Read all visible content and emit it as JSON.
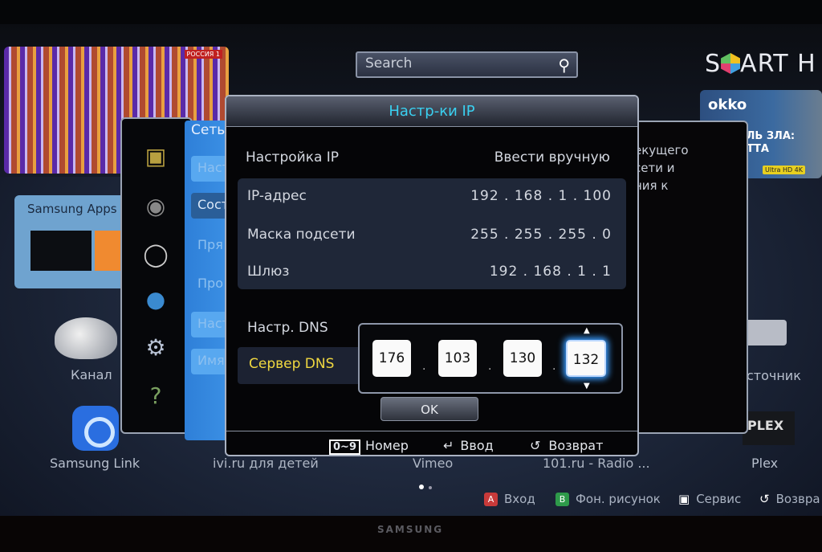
{
  "brand": "SAMSUNG",
  "hub": {
    "logo": "SMART HUB",
    "search_placeholder": "Search",
    "preview_channel": "РОССИЯ 1",
    "okko": {
      "logo": "okko",
      "promo": "ОБИТЕЛЬ ЗЛА: ВЕНДЕТТА",
      "badge": "Ultra HD 4K"
    },
    "tiles": [
      {
        "label": "Samsung Apps"
      },
      {
        "label": "Канал"
      },
      {
        "label": "Samsung Link"
      },
      {
        "label": "Источник"
      },
      {
        "label": "Plex"
      },
      {
        "label": "ivi.ru для детей"
      },
      {
        "label": "Vimeo"
      },
      {
        "label": "101.ru - Radio ..."
      }
    ],
    "plex_logo": "PLEX",
    "page_dots": {
      "current": 1,
      "total": 2
    }
  },
  "settings_menu": {
    "icons": [
      "picture-icon",
      "sound-icon",
      "broadcast-icon",
      "network-globe-icon",
      "gear-icon",
      "help-icon"
    ],
    "network_title": "Сеть",
    "network_items": [
      "Наст",
      "Сост",
      "Пря",
      "Про",
      "Наст",
      "Имя"
    ],
    "description_fragment": [
      "екущего",
      "сети и",
      "ния к"
    ]
  },
  "dialog": {
    "title": "Настр-ки IP",
    "ip_setting": {
      "label": "Настройка IP",
      "value": "Ввести вручную"
    },
    "rows": [
      {
        "label": "IP-адрес",
        "value": "192 . 168 . 1 . 100"
      },
      {
        "label": "Маска подсети",
        "value": "255 . 255 . 255 . 0"
      },
      {
        "label": "Шлюз",
        "value": "192 . 168 . 1 . 1"
      }
    ],
    "dns_setting_label": "Настр. DNS",
    "dns_server_label": "Сервер DNS",
    "dns_octets": [
      "176",
      "103",
      "130",
      "132"
    ],
    "selected_octet": 4,
    "ok_label": "OK",
    "footer": {
      "number_key": "0~9",
      "number": "Номер",
      "enter": "Ввод",
      "return": "Возврат"
    }
  },
  "bottom_bar": {
    "a_key": "A",
    "a_label": "Вход",
    "b_key": "B",
    "b_label": "Фон. рисунок",
    "tools_label": "Сервис",
    "return_label": "Возвра"
  },
  "colors": {
    "accent_title": "#3ad0f0",
    "dns_highlight": "#f0d840",
    "focus_glow": "#3a9cff",
    "a_button": "#c83a3a",
    "b_button": "#2e9a4a"
  }
}
